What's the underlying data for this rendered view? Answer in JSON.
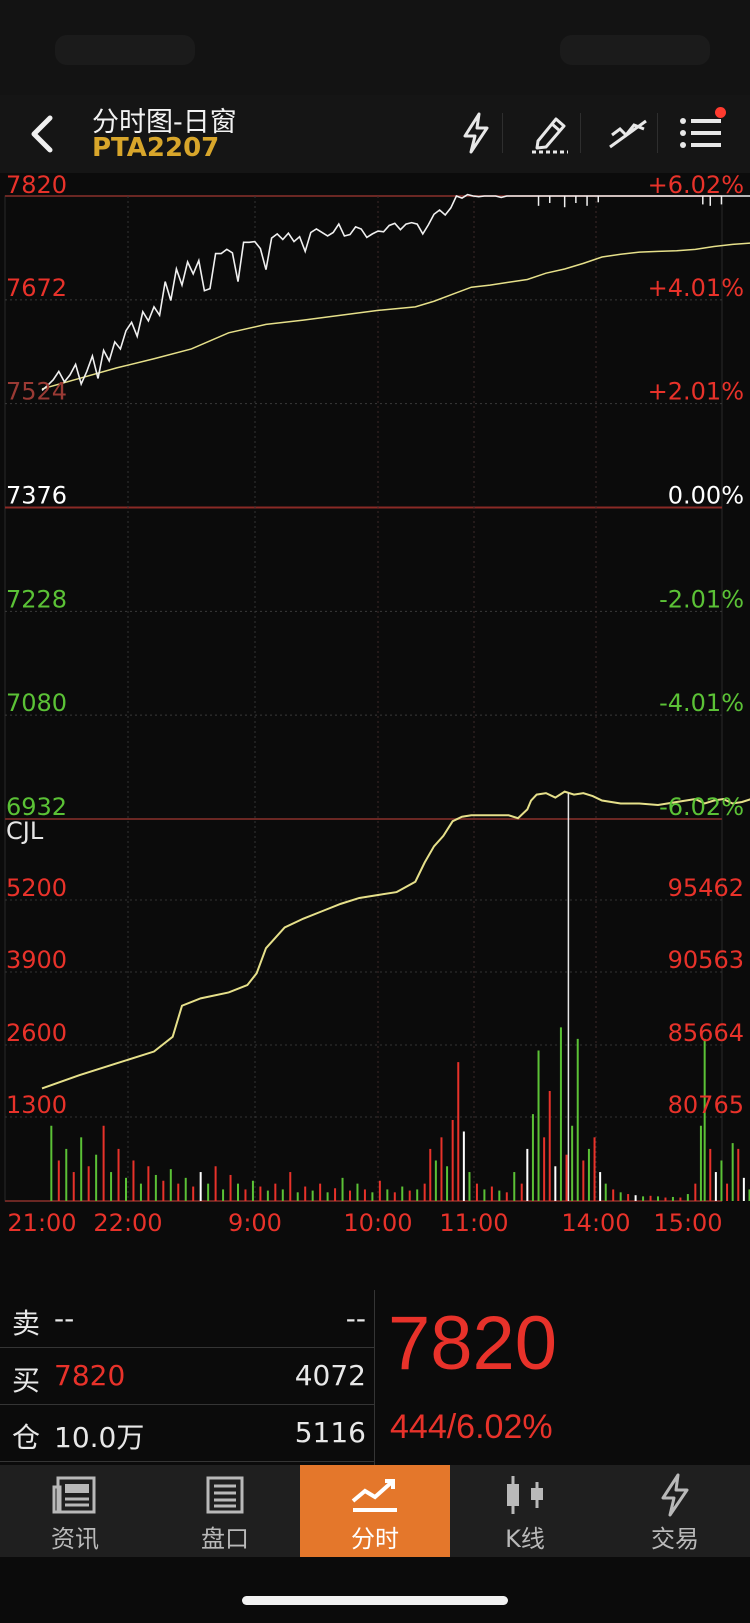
{
  "header": {
    "title": "分时图-日窗",
    "symbol": "PTA2207"
  },
  "colors": {
    "up": "#e8322a",
    "down": "#5bc236",
    "neutral": "#ffffff",
    "price_line": "#f0f0f0",
    "avg_line": "#e6e08a",
    "accent": "#e4772b",
    "symbol": "#d8a62b"
  },
  "chart_data": {
    "type": "line",
    "price_axis": {
      "left_labels": [
        "7820",
        "7672",
        "7524",
        "7376",
        "7228",
        "7080",
        "6932"
      ],
      "right_labels": [
        "+6.02%",
        "+4.01%",
        "+2.01%",
        "0.00%",
        "-2.01%",
        "-4.01%",
        "-6.02%"
      ],
      "ylim": [
        6932,
        7820
      ],
      "reference": 7376
    },
    "time_axis": {
      "labels": [
        "21:00",
        "22:00",
        "9:00",
        "10:00",
        "11:00",
        "14:00",
        "15:00"
      ]
    },
    "price_series": {
      "x": [
        0,
        3,
        6,
        9,
        12,
        15,
        18,
        21,
        24,
        27,
        30,
        33,
        36,
        39,
        42,
        45,
        48,
        51,
        54,
        57,
        60,
        63,
        66,
        69,
        72,
        75,
        78,
        81,
        84,
        87,
        90,
        93,
        96,
        99,
        102,
        105,
        108,
        111,
        114,
        117,
        120,
        123,
        126,
        129,
        132,
        135,
        138,
        141,
        144,
        147,
        150,
        153,
        156,
        159,
        162,
        165,
        168,
        171,
        174,
        177,
        180,
        183,
        186,
        189,
        192,
        195,
        198,
        201,
        204,
        207,
        210,
        213,
        216,
        219,
        222,
        225,
        228,
        231,
        234,
        237,
        240,
        243,
        246,
        249,
        252,
        255,
        258,
        261,
        264,
        267,
        270,
        273,
        276,
        279,
        282,
        285,
        288,
        291,
        294,
        297,
        300,
        303,
        306,
        309,
        312,
        315,
        318,
        321,
        324,
        327,
        330,
        333,
        336,
        339,
        342,
        345,
        348,
        351,
        354,
        357,
        360,
        363,
        366,
        369,
        372,
        375,
        378,
        381,
        384,
        387,
        390
      ],
      "values": [
        7543,
        7550,
        7558,
        7570,
        7555,
        7565,
        7580,
        7552,
        7570,
        7592,
        7560,
        7600,
        7585,
        7612,
        7602,
        7628,
        7640,
        7620,
        7655,
        7642,
        7662,
        7650,
        7698,
        7671,
        7716,
        7693,
        7726,
        7709,
        7728,
        7685,
        7688,
        7738,
        7738,
        7744,
        7739,
        7698,
        7754,
        7754,
        7755,
        7745,
        7715,
        7760,
        7766,
        7758,
        7767,
        7755,
        7762,
        7741,
        7768,
        7773,
        7768,
        7763,
        7768,
        7780,
        7763,
        7765,
        7776,
        7773,
        7761,
        7766,
        7770,
        7769,
        7778,
        7781,
        7772,
        7780,
        7782,
        7780,
        7766,
        7779,
        7794,
        7800,
        7793,
        7803,
        7820,
        7817,
        7822,
        7820,
        7819,
        7820,
        7820,
        7820,
        7818,
        7820,
        7820,
        7820,
        7820,
        7820,
        7820,
        7820,
        7820,
        7820,
        7820,
        7820,
        7820,
        7820,
        7820,
        7820,
        7820,
        7820,
        7820,
        7820,
        7820,
        7820,
        7820,
        7820,
        7820,
        7820,
        7820,
        7820,
        7820,
        7820,
        7820,
        7820,
        7820,
        7820,
        7820,
        7820,
        7820,
        7820,
        7820,
        7820,
        7820,
        7820,
        7820,
        7820,
        7820,
        7820,
        7820,
        7820,
        7820
      ],
      "dips": [
        [
          266,
          7806
        ],
        [
          272,
          7810
        ],
        [
          280,
          7804
        ],
        [
          286,
          7810
        ],
        [
          292,
          7806
        ],
        [
          298,
          7811
        ],
        [
          354,
          7808
        ],
        [
          358,
          7806
        ],
        [
          364,
          7808
        ]
      ]
    },
    "avg_series": {
      "x": [
        0,
        20,
        40,
        60,
        80,
        100,
        120,
        140,
        160,
        180,
        200,
        210,
        220,
        230,
        240,
        250,
        260,
        270,
        280,
        290,
        300,
        310,
        320,
        330,
        340,
        350,
        360,
        370,
        380,
        390
      ],
      "values": [
        7545,
        7560,
        7575,
        7588,
        7602,
        7625,
        7637,
        7643,
        7650,
        7657,
        7662,
        7670,
        7680,
        7690,
        7693,
        7697,
        7701,
        7710,
        7716,
        7724,
        7733,
        7737,
        7740,
        7741,
        7742,
        7744,
        7748,
        7751,
        7753,
        7755
      ]
    },
    "volume_panel": {
      "title": "CJL",
      "left_labels": [
        "5200",
        "3900",
        "2600",
        "1300"
      ],
      "right_labels": [
        "95462",
        "90563",
        "85664",
        "80765"
      ]
    },
    "position_series": {
      "x": [
        0,
        20,
        40,
        60,
        70,
        75,
        85,
        100,
        110,
        115,
        120,
        130,
        140,
        150,
        160,
        170,
        180,
        190,
        200,
        205,
        210,
        215,
        220,
        225,
        230,
        240,
        250,
        255,
        260,
        262,
        265,
        270,
        275,
        280,
        285,
        290,
        295,
        300,
        310,
        320,
        330,
        340,
        350,
        355,
        360,
        365,
        370,
        375,
        380,
        385,
        390
      ],
      "values": [
        82700,
        83600,
        84400,
        85200,
        86200,
        88300,
        88800,
        89200,
        89700,
        90500,
        92200,
        93600,
        94200,
        94700,
        95200,
        95600,
        95800,
        96000,
        96700,
        98000,
        99100,
        99800,
        100800,
        101100,
        101200,
        101200,
        101200,
        101000,
        101600,
        102200,
        102600,
        102700,
        102400,
        102800,
        102600,
        102700,
        102500,
        102200,
        102000,
        102000,
        101900,
        102100,
        102300,
        102000,
        102200,
        102300,
        102000,
        102100,
        102300,
        102000,
        102000
      ]
    },
    "volume_bars": [
      {
        "x": 5,
        "h": 1300,
        "c": "down"
      },
      {
        "x": 9,
        "h": 700,
        "c": "up"
      },
      {
        "x": 13,
        "h": 900,
        "c": "down"
      },
      {
        "x": 17,
        "h": 500,
        "c": "up"
      },
      {
        "x": 21,
        "h": 1100,
        "c": "down"
      },
      {
        "x": 25,
        "h": 600,
        "c": "up"
      },
      {
        "x": 29,
        "h": 800,
        "c": "down"
      },
      {
        "x": 33,
        "h": 1300,
        "c": "up"
      },
      {
        "x": 37,
        "h": 500,
        "c": "down"
      },
      {
        "x": 41,
        "h": 900,
        "c": "up"
      },
      {
        "x": 45,
        "h": 400,
        "c": "down"
      },
      {
        "x": 49,
        "h": 700,
        "c": "up"
      },
      {
        "x": 53,
        "h": 300,
        "c": "down"
      },
      {
        "x": 57,
        "h": 600,
        "c": "up"
      },
      {
        "x": 61,
        "h": 450,
        "c": "down"
      },
      {
        "x": 65,
        "h": 350,
        "c": "up"
      },
      {
        "x": 69,
        "h": 550,
        "c": "down"
      },
      {
        "x": 73,
        "h": 300,
        "c": "up"
      },
      {
        "x": 77,
        "h": 400,
        "c": "down"
      },
      {
        "x": 81,
        "h": 250,
        "c": "up"
      },
      {
        "x": 85,
        "h": 500,
        "c": "neutral"
      },
      {
        "x": 89,
        "h": 300,
        "c": "down"
      },
      {
        "x": 93,
        "h": 600,
        "c": "up"
      },
      {
        "x": 97,
        "h": 200,
        "c": "down"
      },
      {
        "x": 101,
        "h": 450,
        "c": "up"
      },
      {
        "x": 105,
        "h": 300,
        "c": "down"
      },
      {
        "x": 109,
        "h": 200,
        "c": "up"
      },
      {
        "x": 113,
        "h": 350,
        "c": "down"
      },
      {
        "x": 117,
        "h": 250,
        "c": "up"
      },
      {
        "x": 121,
        "h": 180,
        "c": "down"
      },
      {
        "x": 125,
        "h": 300,
        "c": "up"
      },
      {
        "x": 129,
        "h": 200,
        "c": "down"
      },
      {
        "x": 133,
        "h": 500,
        "c": "up"
      },
      {
        "x": 137,
        "h": 150,
        "c": "down"
      },
      {
        "x": 141,
        "h": 250,
        "c": "up"
      },
      {
        "x": 145,
        "h": 180,
        "c": "down"
      },
      {
        "x": 149,
        "h": 300,
        "c": "up"
      },
      {
        "x": 153,
        "h": 150,
        "c": "down"
      },
      {
        "x": 157,
        "h": 220,
        "c": "up"
      },
      {
        "x": 161,
        "h": 400,
        "c": "down"
      },
      {
        "x": 165,
        "h": 180,
        "c": "up"
      },
      {
        "x": 169,
        "h": 300,
        "c": "down"
      },
      {
        "x": 173,
        "h": 200,
        "c": "up"
      },
      {
        "x": 177,
        "h": 150,
        "c": "down"
      },
      {
        "x": 181,
        "h": 350,
        "c": "up"
      },
      {
        "x": 185,
        "h": 200,
        "c": "down"
      },
      {
        "x": 189,
        "h": 150,
        "c": "up"
      },
      {
        "x": 193,
        "h": 250,
        "c": "down"
      },
      {
        "x": 197,
        "h": 180,
        "c": "up"
      },
      {
        "x": 201,
        "h": 200,
        "c": "down"
      },
      {
        "x": 205,
        "h": 300,
        "c": "up"
      },
      {
        "x": 208,
        "h": 900,
        "c": "up"
      },
      {
        "x": 211,
        "h": 700,
        "c": "down"
      },
      {
        "x": 214,
        "h": 1100,
        "c": "up"
      },
      {
        "x": 217,
        "h": 600,
        "c": "down"
      },
      {
        "x": 220,
        "h": 1400,
        "c": "up"
      },
      {
        "x": 223,
        "h": 2400,
        "c": "up"
      },
      {
        "x": 226,
        "h": 1200,
        "c": "neutral"
      },
      {
        "x": 229,
        "h": 500,
        "c": "down"
      },
      {
        "x": 233,
        "h": 300,
        "c": "up"
      },
      {
        "x": 237,
        "h": 200,
        "c": "down"
      },
      {
        "x": 241,
        "h": 250,
        "c": "up"
      },
      {
        "x": 245,
        "h": 180,
        "c": "down"
      },
      {
        "x": 249,
        "h": 150,
        "c": "up"
      },
      {
        "x": 253,
        "h": 500,
        "c": "down"
      },
      {
        "x": 257,
        "h": 300,
        "c": "up"
      },
      {
        "x": 260,
        "h": 900,
        "c": "neutral"
      },
      {
        "x": 263,
        "h": 1500,
        "c": "down"
      },
      {
        "x": 266,
        "h": 2600,
        "c": "down"
      },
      {
        "x": 269,
        "h": 1100,
        "c": "up"
      },
      {
        "x": 272,
        "h": 1900,
        "c": "up"
      },
      {
        "x": 275,
        "h": 600,
        "c": "neutral"
      },
      {
        "x": 278,
        "h": 3000,
        "c": "down"
      },
      {
        "x": 281,
        "h": 800,
        "c": "up"
      },
      {
        "x": 284,
        "h": 1300,
        "c": "down"
      },
      {
        "x": 287,
        "h": 2800,
        "c": "down"
      },
      {
        "x": 290,
        "h": 700,
        "c": "up"
      },
      {
        "x": 293,
        "h": 900,
        "c": "down"
      },
      {
        "x": 296,
        "h": 1100,
        "c": "up"
      },
      {
        "x": 299,
        "h": 500,
        "c": "neutral"
      },
      {
        "x": 302,
        "h": 300,
        "c": "down"
      },
      {
        "x": 306,
        "h": 200,
        "c": "up"
      },
      {
        "x": 310,
        "h": 150,
        "c": "down"
      },
      {
        "x": 314,
        "h": 120,
        "c": "up"
      },
      {
        "x": 318,
        "h": 100,
        "c": "neutral"
      },
      {
        "x": 322,
        "h": 80,
        "c": "down"
      },
      {
        "x": 326,
        "h": 90,
        "c": "up"
      },
      {
        "x": 330,
        "h": 80,
        "c": "down"
      },
      {
        "x": 334,
        "h": 60,
        "c": "up"
      },
      {
        "x": 338,
        "h": 70,
        "c": "down"
      },
      {
        "x": 342,
        "h": 60,
        "c": "up"
      },
      {
        "x": 346,
        "h": 120,
        "c": "down"
      },
      {
        "x": 350,
        "h": 300,
        "c": "up"
      },
      {
        "x": 353,
        "h": 1300,
        "c": "down"
      },
      {
        "x": 355,
        "h": 2800,
        "c": "down"
      },
      {
        "x": 358,
        "h": 900,
        "c": "up"
      },
      {
        "x": 361,
        "h": 500,
        "c": "neutral"
      },
      {
        "x": 364,
        "h": 700,
        "c": "down"
      },
      {
        "x": 367,
        "h": 300,
        "c": "up"
      },
      {
        "x": 370,
        "h": 1000,
        "c": "down"
      },
      {
        "x": 373,
        "h": 900,
        "c": "up"
      },
      {
        "x": 376,
        "h": 400,
        "c": "neutral"
      },
      {
        "x": 379,
        "h": 200,
        "c": "down"
      },
      {
        "x": 383,
        "h": 150,
        "c": "up"
      },
      {
        "x": 387,
        "h": 100,
        "c": "neutral"
      }
    ]
  },
  "quote": {
    "sell_label": "卖",
    "sell_price": "--",
    "sell_vol": "--",
    "buy_label": "买",
    "buy_price": "7820",
    "buy_vol": "4072",
    "pos_label": "仓",
    "pos_value": "10.0万",
    "pos_change": "5116",
    "last_price": "7820",
    "change": "444/6.02%"
  },
  "tabs": [
    {
      "label": "资讯",
      "icon": "news-icon"
    },
    {
      "label": "盘口",
      "icon": "orderbook-icon"
    },
    {
      "label": "分时",
      "icon": "timeshare-icon"
    },
    {
      "label": "K线",
      "icon": "candlestick-icon"
    },
    {
      "label": "交易",
      "icon": "lightning-icon"
    }
  ]
}
